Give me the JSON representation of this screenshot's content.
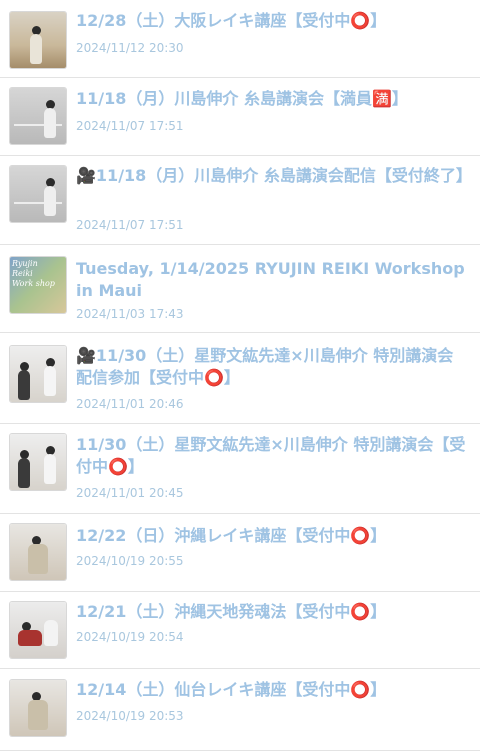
{
  "items": [
    {
      "title": "12/28（土）大阪レイキ講座【受付中⭕️】",
      "date": "2024/11/12 20:30"
    },
    {
      "title": "11/18（月）川島伸介 糸島講演会【満員🈵】",
      "date": "2024/11/07 17:51"
    },
    {
      "title": "🎥11/18（月）川島伸介 糸島講演会配信【受付終了】",
      "date": "2024/11/07 17:51"
    },
    {
      "title": "Tuesday, 1/14/2025 RYUJIN REIKI Workshop in Maui",
      "date": "2024/11/03 17:43",
      "thumb_text": "Ryujin\nReiki\nWork shop"
    },
    {
      "title": "🎥11/30（土）星野文紘先達×川島伸介 特別講演会 配信参加【受付中⭕️】",
      "date": "2024/11/01 20:46"
    },
    {
      "title": "11/30（土）星野文紘先達×川島伸介 特別講演会【受付中⭕️】",
      "date": "2024/11/01 20:45"
    },
    {
      "title": "12/22（日）沖縄レイキ講座【受付中⭕️】",
      "date": "2024/10/19 20:55"
    },
    {
      "title": "12/21（土）沖縄天地発魂法【受付中⭕️】",
      "date": "2024/10/19 20:54"
    },
    {
      "title": "12/14（土）仙台レイキ講座【受付中⭕️】",
      "date": "2024/10/19 20:53"
    }
  ]
}
